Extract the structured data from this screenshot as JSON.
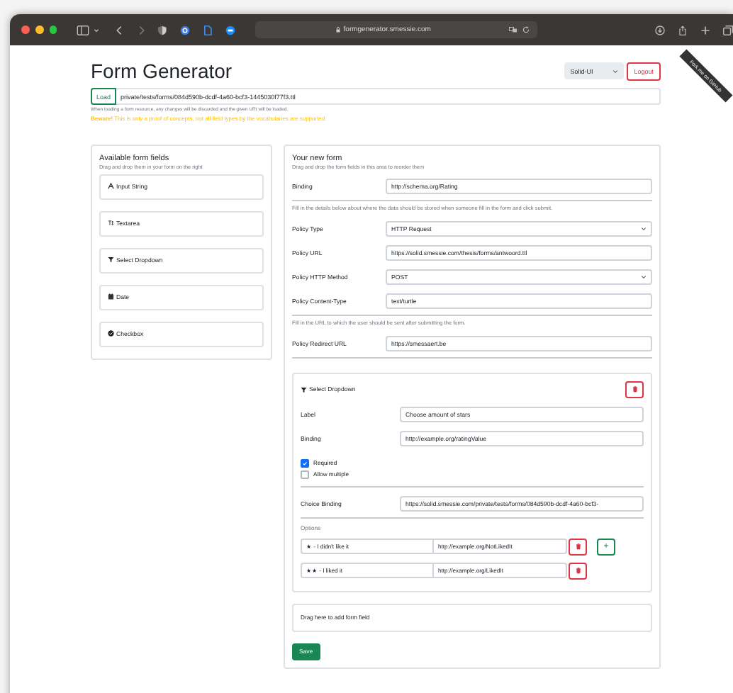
{
  "browser": {
    "url": "formgenerator.smessie.com"
  },
  "ribbon": "Fork me on GitHub",
  "header": {
    "title": "Form Generator",
    "theme": "Solid-UI",
    "logout": "Logout"
  },
  "load": {
    "button": "Load",
    "value": "private/tests/forms/084d590b-dcdf-4a60-bcf3-1445030f77f3.ttl",
    "help": "When loading a form resource, any changes will be discarded and the given URI will be loaded.",
    "warning": "**Beware!** This is only a proof of concepts, not all field types by the vocabularies are supported."
  },
  "available": {
    "title": "Available form fields",
    "subtitle": "Drag and drop them in your form on the right",
    "items": [
      {
        "kind": "input",
        "label": "Input String"
      },
      {
        "kind": "textarea",
        "label": "Textarea"
      },
      {
        "kind": "select",
        "label": "Select Dropdown"
      },
      {
        "kind": "date",
        "label": "Date"
      },
      {
        "kind": "checkbox",
        "label": "Checkbox"
      }
    ]
  },
  "form": {
    "title": "Your new form",
    "subtitle": "Drag and drop the form fields in this area to reorder them",
    "binding": {
      "label": "Binding",
      "value": "http://schema.org/Rating"
    },
    "policy_note": "Fill in the details below about where the data should be stored when someone fill in the form and click submit.",
    "policy_fields": [
      {
        "kind": "select",
        "label": "Policy Type",
        "value": "HTTP Request"
      },
      {
        "kind": "text",
        "label": "Policy URL",
        "value": "https://solid.smessie.com/thesis/forms/antwoord.ttl"
      },
      {
        "kind": "select",
        "label": "Policy HTTP Method",
        "value": "POST"
      },
      {
        "kind": "text",
        "label": "Policy Content-Type",
        "value": "text/turtle"
      }
    ],
    "redirect_note": "Fill in the URL to which the user should be sent after submitting the form.",
    "redirect": {
      "label": "Policy Redirect URL",
      "value": "https://smessaert.be"
    },
    "fields": [
      {
        "kind": "select",
        "title": "Select Dropdown",
        "inputs": [
          {
            "label": "Label",
            "value": "Choose amount of stars"
          },
          {
            "label": "Binding",
            "value": "http://example.org/ratingValue"
          }
        ],
        "checks": [
          {
            "label": "Required",
            "checked": true
          },
          {
            "label": "Allow multiple",
            "checked": false
          }
        ],
        "choice_binding": {
          "label": "Choice Binding",
          "value": "https://solid.smessie.com/private/tests/forms/084d590b-dcdf-4a60-bcf3-"
        },
        "options_title": "Options",
        "options": [
          {
            "label": "★ - I didn't like it",
            "value": "http://example.org/NotLikedIt"
          },
          {
            "label": "★★ - I liked it",
            "value": "http://example.org/LikedIt"
          }
        ],
        "add": "+"
      }
    ],
    "drop_hint": "Drag here to add form field",
    "save": "Save"
  }
}
